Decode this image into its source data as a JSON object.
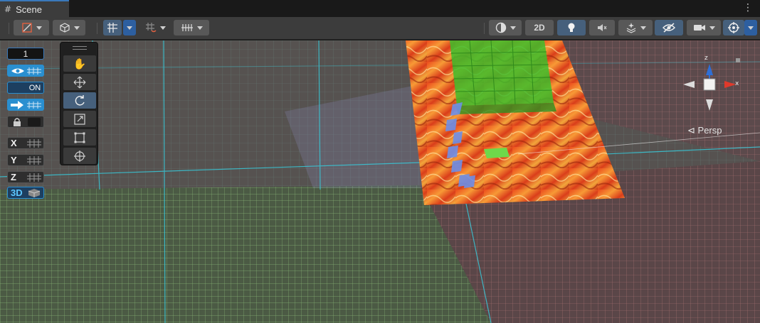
{
  "tab": {
    "title": "Scene",
    "icon": "hash-icon"
  },
  "menu": {
    "more_icon": "⋮"
  },
  "toolbar": {
    "view_2d_label": "2D",
    "left_groups": [
      "draw-mode-dropdown",
      "scene-object-dropdown",
      "grid-snap-dropdown",
      "increment-snap-dropdown",
      "grid-ruler-dropdown"
    ],
    "right_groups": [
      "shading-mode-dropdown",
      "2d-toggle",
      "lighting-toggle",
      "audio-toggle",
      "effects-dropdown",
      "visibility-toggle",
      "camera-dropdown",
      "gizmos-dropdown"
    ]
  },
  "left_panel": {
    "grid_count": "1",
    "on_label": "ON",
    "axis_x": "X",
    "axis_y": "Y",
    "axis_z": "Z",
    "mode_3d": "3D"
  },
  "tools": [
    "hand-tool",
    "move-tool",
    "rotate-tool",
    "scale-tool",
    "rect-tool",
    "transform-tool"
  ],
  "gizmo": {
    "view_label": "Persp",
    "axis_z": "z",
    "axis_x": "x",
    "colors": {
      "x": "#e0392b",
      "y": "#8fd14f",
      "z": "#2f6fd6"
    }
  },
  "colors": {
    "accent_blue": "#3a79bb",
    "lava_orange": "#e8632a",
    "grid_cyan": "#38c8d8",
    "selected_tool": "#46607c"
  }
}
